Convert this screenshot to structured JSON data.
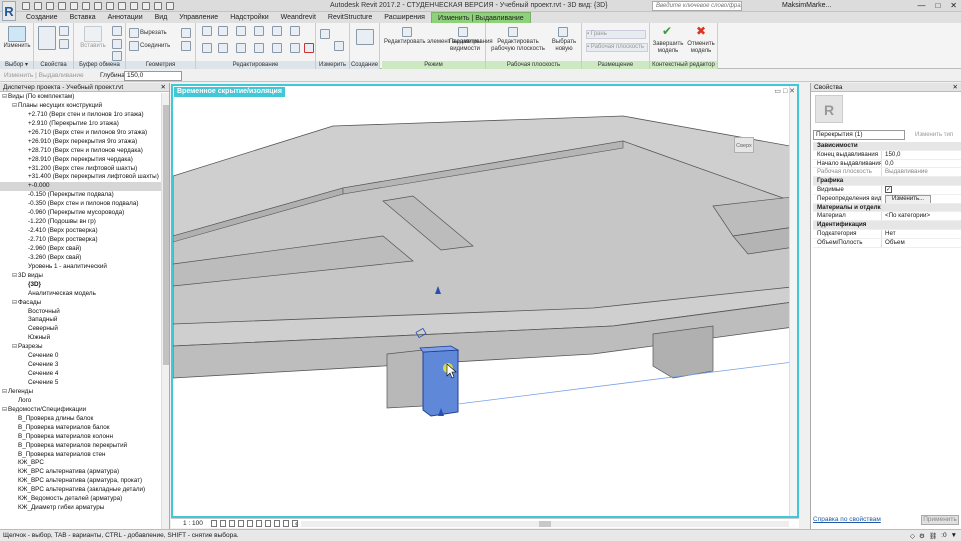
{
  "app": {
    "logo": "R",
    "title": "Autodesk Revit 2017.2 - СТУДЕНЧЕСКАЯ ВЕРСИЯ -   Учебный проект.rvt - 3D вид: {3D}",
    "search_placeholder": "Введите ключевое слово/фразу",
    "user": "MaksimMarke...",
    "win_min": "—",
    "win_max": "□",
    "win_close": "✕"
  },
  "tabs": [
    {
      "label": "Создание"
    },
    {
      "label": "Вставка"
    },
    {
      "label": "Аннотации"
    },
    {
      "label": "Вид"
    },
    {
      "label": "Управление"
    },
    {
      "label": "Надстройки"
    },
    {
      "label": "Weandrevit"
    },
    {
      "label": "RevitStructure"
    },
    {
      "label": "Расширения"
    },
    {
      "label": "Изменить | Выдавливание"
    }
  ],
  "ribbon": {
    "modify_label": "Изменить",
    "cut_label": "Вырезать",
    "join_label": "Соединить",
    "paste_label": "Вставить",
    "edit_extrusion": "Редактировать элемент выдавливания",
    "visibility_params": "Параметры видимости",
    "edit_workplane": "Редактировать рабочую плоскость",
    "choose_new": "Выбрать новую",
    "faces": "Грань",
    "workplane_opt": "Рабочая плоскость",
    "finish_model": "Завершить модель",
    "cancel_model": "Отменить модель",
    "groups": {
      "select": "Выбор ▾",
      "properties": "Свойства",
      "clipboard": "Буфер обмена",
      "geometry": "Геометрия",
      "edit": "Редактирование",
      "measure": "Измерить",
      "create": "Создание",
      "mode": "Режим",
      "workplane": "Рабочая плоскость",
      "placement": "Размещение",
      "context": "Контекстный редактор"
    }
  },
  "optionsbar": {
    "modify_label": "Изменить | Выдавливание",
    "depth_label": "Глубина",
    "depth_value": "150,0"
  },
  "browser": {
    "title": "Диспетчер проекта - Учебный проект.rvt",
    "close": "✕",
    "items": [
      {
        "indent": 0,
        "exp": "⊟",
        "label": "Виды (По комплектам)"
      },
      {
        "indent": 1,
        "exp": "⊟",
        "label": "Планы несущих конструкций"
      },
      {
        "indent": 2,
        "exp": "",
        "label": "+2.710 (Верх стен и пилонов 1го этажа)"
      },
      {
        "indent": 2,
        "exp": "",
        "label": "+2.910 (Перекрытие 1го этажа)"
      },
      {
        "indent": 2,
        "exp": "",
        "label": "+26.710 (Верх стен и пилонов 9го этажа)"
      },
      {
        "indent": 2,
        "exp": "",
        "label": "+26.910 (Верх перекрытия 9го этажа)"
      },
      {
        "indent": 2,
        "exp": "",
        "label": "+28.710 (Верх стен и пилонов чердака)"
      },
      {
        "indent": 2,
        "exp": "",
        "label": "+28.910 (Верх перекрытия чердака)"
      },
      {
        "indent": 2,
        "exp": "",
        "label": "+31.200 (Верх стен лифтовой шахты)"
      },
      {
        "indent": 2,
        "exp": "",
        "label": "+31.400 (Верх перекрытия лифтовой шахты)"
      },
      {
        "indent": 2,
        "exp": "",
        "label": "+-0.000",
        "sel": true
      },
      {
        "indent": 2,
        "exp": "",
        "label": "-0.150 (Перекрытие подвала)"
      },
      {
        "indent": 2,
        "exp": "",
        "label": "-0.350 (Верх стен и пилонов подвала)"
      },
      {
        "indent": 2,
        "exp": "",
        "label": "-0.960 (Перекрытие мусоровода)"
      },
      {
        "indent": 2,
        "exp": "",
        "label": "-1.220 (Подошвы вн гр)"
      },
      {
        "indent": 2,
        "exp": "",
        "label": "-2.410 (Верх ростверка)"
      },
      {
        "indent": 2,
        "exp": "",
        "label": "-2.710 (Верх ростверка)"
      },
      {
        "indent": 2,
        "exp": "",
        "label": "-2.960 (Верх свай)"
      },
      {
        "indent": 2,
        "exp": "",
        "label": "-3.260 (Верх свай)"
      },
      {
        "indent": 2,
        "exp": "",
        "label": "Уровень 1 - аналитический"
      },
      {
        "indent": 1,
        "exp": "⊟",
        "label": "3D виды"
      },
      {
        "indent": 2,
        "exp": "",
        "label": "{3D}",
        "bold": true
      },
      {
        "indent": 2,
        "exp": "",
        "label": "Аналитическая модель"
      },
      {
        "indent": 1,
        "exp": "⊟",
        "label": "Фасады"
      },
      {
        "indent": 2,
        "exp": "",
        "label": "Восточный"
      },
      {
        "indent": 2,
        "exp": "",
        "label": "Западный"
      },
      {
        "indent": 2,
        "exp": "",
        "label": "Северный"
      },
      {
        "indent": 2,
        "exp": "",
        "label": "Южный"
      },
      {
        "indent": 1,
        "exp": "⊟",
        "label": "Разрезы"
      },
      {
        "indent": 2,
        "exp": "",
        "label": "Сечение 0"
      },
      {
        "indent": 2,
        "exp": "",
        "label": "Сечение 3"
      },
      {
        "indent": 2,
        "exp": "",
        "label": "Сечение 4"
      },
      {
        "indent": 2,
        "exp": "",
        "label": "Сечение 5"
      },
      {
        "indent": 0,
        "exp": "⊟",
        "label": "Легенды"
      },
      {
        "indent": 1,
        "exp": "",
        "label": "Лого"
      },
      {
        "indent": 0,
        "exp": "⊟",
        "label": "Ведомости/Спецификации"
      },
      {
        "indent": 1,
        "exp": "",
        "label": "В_Проверка длины балок"
      },
      {
        "indent": 1,
        "exp": "",
        "label": "В_Проверка материалов балок"
      },
      {
        "indent": 1,
        "exp": "",
        "label": "В_Проверка материалов колонн"
      },
      {
        "indent": 1,
        "exp": "",
        "label": "В_Проверка материалов перекрытий"
      },
      {
        "indent": 1,
        "exp": "",
        "label": "В_Проверка материалов стен"
      },
      {
        "indent": 1,
        "exp": "",
        "label": "КЖ_ВРС"
      },
      {
        "indent": 1,
        "exp": "",
        "label": "КЖ_ВРС альтернатива (арматура)"
      },
      {
        "indent": 1,
        "exp": "",
        "label": "КЖ_ВРС альтернатива (арматура, прокат)"
      },
      {
        "indent": 1,
        "exp": "",
        "label": "КЖ_ВРС альтернатива (закладные детали)"
      },
      {
        "indent": 1,
        "exp": "",
        "label": "КЖ_Ведомость деталей (арматура)"
      },
      {
        "indent": 1,
        "exp": "",
        "label": "КЖ_Диаметр гибки арматуры"
      }
    ]
  },
  "viewport": {
    "title": "Временное скрытие/изоляция",
    "win_controls": "▭ □ ✕",
    "viewcube_face": "Сверх",
    "scale": "1 : 100",
    "scroll_arrow": "‹"
  },
  "properties": {
    "title": "Свойства",
    "close": "✕",
    "type_icon": "R",
    "type_name": "Перекрытия (1)",
    "edit_type": "Изменить тип",
    "rows": [
      {
        "cat": true,
        "name": "Зависимости",
        "value": ""
      },
      {
        "name": "Конец выдавливания",
        "value": "150,0"
      },
      {
        "name": "Начало выдавливания",
        "value": "0,0"
      },
      {
        "name": "Рабочая плоскость",
        "value": "Выдавливание",
        "ro": true
      },
      {
        "cat": true,
        "name": "Графика",
        "value": ""
      },
      {
        "name": "Видимые",
        "value": "✓",
        "kind": "check"
      },
      {
        "name": "Переопределения вид...",
        "value": "Изменить...",
        "kind": "button"
      },
      {
        "cat": true,
        "name": "Материалы и отделка",
        "value": ""
      },
      {
        "name": "Материал",
        "value": "<По категории>"
      },
      {
        "cat": true,
        "name": "Идентификация",
        "value": ""
      },
      {
        "name": "Подкатегория",
        "value": "Нет"
      },
      {
        "name": "Объем/Полость",
        "value": "Объем"
      }
    ],
    "help_link": "Справка по свойствам",
    "apply": "Применить"
  },
  "statusbar": {
    "text": "Щелчок - выбор, TAB - варианты, CTRL - добавление, SHIFT - снятие выбора.",
    "filter_count": ":0"
  }
}
